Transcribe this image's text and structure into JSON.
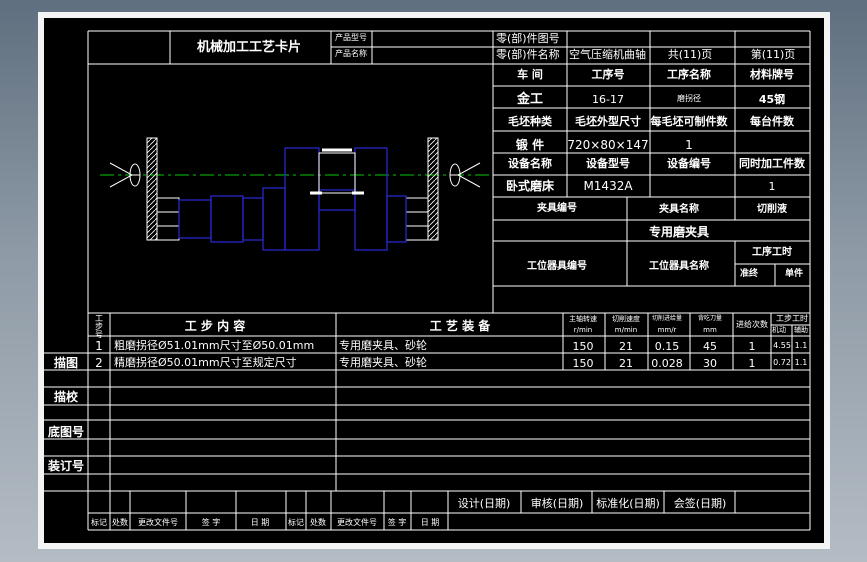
{
  "card": {
    "title": "机械加工工艺卡片",
    "product_model_label": "产品型号",
    "product_name_label": "产品名称",
    "part_drawing_no_label": "零(部)件图号",
    "part_name_label": "零(部)件名称",
    "part_name": "空气压缩机曲轴",
    "total_pages": "共(11)页",
    "page_no": "第(11)页"
  },
  "info": {
    "workshop_label": "车 间",
    "op_no_label": "工序号",
    "op_name_label": "工序名称",
    "material_label": "材料牌号",
    "workshop": "金工",
    "op_no": "16-17",
    "op_name": "磨拐径",
    "material": "45钢",
    "blank_type_label": "毛坯种类",
    "blank_size_label": "毛坯外型尺寸",
    "pieces_per_blank_label": "每毛坯可制件数",
    "pieces_per_unit_label": "每台件数",
    "blank_type": "锻 件",
    "blank_size": "720×80×147",
    "pieces_per_blank": "1",
    "equip_name_label": "设备名称",
    "equip_model_label": "设备型号",
    "equip_no_label": "设备编号",
    "simul_parts_label": "同时加工件数",
    "equip_name": "卧式磨床",
    "equip_model": "M1432A",
    "simul_parts": "1",
    "fixture_no_label": "夹具编号",
    "fixture_name_label": "夹具名称",
    "coolant_label": "切削液",
    "fixture_name": "专用磨夹具",
    "station_tool_no_label": "工位器具编号",
    "station_tool_name_label": "工位器具名称",
    "op_time_label": "工序工时",
    "prep_time_label": "准终",
    "unit_time_label": "单件"
  },
  "steps": {
    "header": {
      "step_no": "工步号",
      "content": "工 步 内 容",
      "equipment": "工 艺 装 备",
      "spindle_speed": "主轴转速",
      "spindle_unit": "r/min",
      "cut_speed": "切削速度",
      "cut_unit": "m/min",
      "feed": "切削进给量",
      "feed_unit": "mm/r",
      "depth": "背吃刀量",
      "depth_unit": "mm",
      "passes": "进给次数",
      "step_time": "工步工时",
      "machine": "机动",
      "aux": "辅助"
    },
    "rows": [
      {
        "no": "1",
        "content": "粗磨拐径Ø51.01mm尺寸至Ø50.01mm",
        "equipment": "专用磨夹具、砂轮",
        "speed": "150",
        "cut": "21",
        "feed": "0.15",
        "depth": "45",
        "passes": "1",
        "machine": "4.55",
        "aux": "1.1"
      },
      {
        "no": "2",
        "content": "精磨拐径Ø50.01mm尺寸至规定尺寸",
        "equipment": "专用磨夹具、砂轮",
        "speed": "150",
        "cut": "21",
        "feed": "0.028",
        "depth": "30",
        "passes": "1",
        "machine": "0.72",
        "aux": "1.1"
      }
    ]
  },
  "side": {
    "trace": "描图",
    "check": "描校",
    "base_no": "底图号",
    "binding_no": "装订号"
  },
  "signoff": {
    "design": "设计(日期)",
    "review": "审核(日期)",
    "standard": "标准化(日期)",
    "countersign": "会签(日期)"
  },
  "revision": {
    "mark": "标记",
    "count": "处数",
    "doc_no": "更改文件号",
    "sign": "签 字",
    "date": "日 期"
  },
  "colors": {
    "outer_bg": "#7d8a96",
    "paper": "#f4f4f4",
    "frame": "#000000",
    "grid": "#ffffff",
    "part_blue": "#2a2ad8",
    "center_line": "#00c800"
  }
}
